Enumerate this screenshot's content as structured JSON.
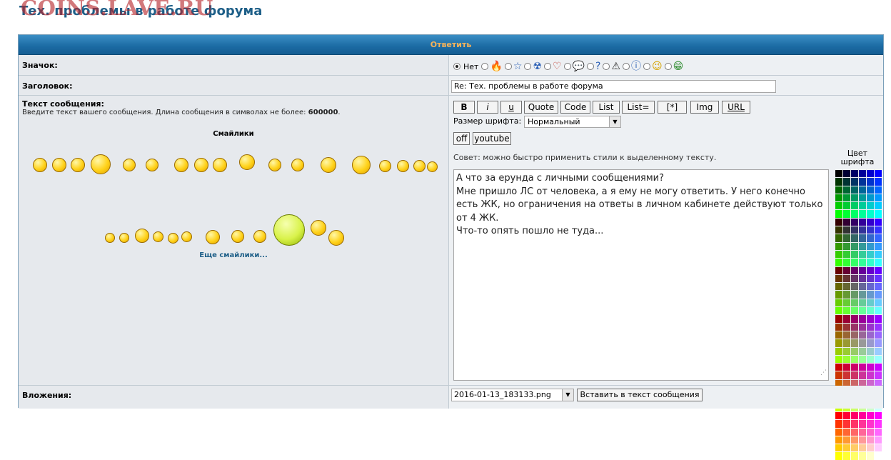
{
  "page": {
    "title": "Тех. проблемы в работе форума",
    "watermark": "COINS.LAVE.RU"
  },
  "form": {
    "header": "Ответить",
    "icon_row": {
      "label": "Значок:",
      "none_label": "Нет",
      "icons": [
        {
          "name": "fire-icon",
          "glyph": "🔥",
          "color": "#d64a1c"
        },
        {
          "name": "star-icon",
          "glyph": "☆",
          "color": "#2a5fb5"
        },
        {
          "name": "radioactive-icon",
          "glyph": "☢",
          "color": "#2a5fb5"
        },
        {
          "name": "heart-icon",
          "glyph": "♡",
          "color": "#c0392b"
        },
        {
          "name": "speech-bubble-icon",
          "glyph": "💬",
          "color": "#2a5fb5"
        },
        {
          "name": "question-icon",
          "glyph": "?",
          "color": "#2a5fb5"
        },
        {
          "name": "warning-icon",
          "glyph": "⚠",
          "color": "#333333"
        },
        {
          "name": "info-icon",
          "glyph": "ⓘ",
          "color": "#2a5fb5"
        },
        {
          "name": "wink-smiley-icon",
          "glyph": "😉",
          "color": "#d6a400"
        },
        {
          "name": "grin-smiley-icon",
          "glyph": "😁",
          "color": "#2e8b2e"
        }
      ]
    },
    "subject": {
      "label": "Заголовок:",
      "value": "Re: Тех. проблемы в работе форума"
    },
    "message": {
      "label": "Текст сообщения:",
      "hint_prefix": "Введите текст вашего сообщения. Длина сообщения в символах не более: ",
      "max_len": "600000",
      "hint_suffix": ".",
      "smilies_title": "Смайлики",
      "more_smilies": "Еще смайлики...",
      "toolbar": [
        "B",
        "i",
        "u",
        "Quote",
        "Code",
        "List",
        "List=",
        "[*]",
        "Img",
        "URL"
      ],
      "font_size_label": "Размер шрифта:",
      "font_size_value": "Нормальный",
      "extra_buttons": [
        "off",
        "youtube"
      ],
      "tip": "Совет: можно быстро применить стили к выделенному тексту.",
      "font_color_label_1": "Цвет",
      "font_color_label_2": "шрифта",
      "text": "А что за ерунда с личными сообщениями?\nМне пришло ЛС от человека, а я ему не могу ответить. У него конечно есть ЖК, но ограничения на ответы в личном кабинете действуют только от 4 ЖК.\nЧто-то опять пошло не туда..."
    },
    "attachments": {
      "label": "Вложения:",
      "file": "2016-01-13_183133.png",
      "insert_button": "Вставить в текст сообщения"
    }
  },
  "colors": {
    "header_bg": "#1b6aa3",
    "header_text": "#f7b35a",
    "title": "#1e5f88",
    "watermark": "#b8262c",
    "link": "#1e5f88"
  },
  "palette": [
    "#000000",
    "#000033",
    "#000066",
    "#000099",
    "#0000cc",
    "#0000ff",
    "#003300",
    "#003333",
    "#003366",
    "#003399",
    "#0033cc",
    "#0033ff",
    "#006600",
    "#006633",
    "#006666",
    "#006699",
    "#0066cc",
    "#0066ff",
    "#009900",
    "#009933",
    "#009966",
    "#009999",
    "#0099cc",
    "#0099ff",
    "#00cc00",
    "#00cc33",
    "#00cc66",
    "#00cc99",
    "#00cccc",
    "#00ccff",
    "#00ff00",
    "#00ff33",
    "#00ff66",
    "#00ff99",
    "#00ffcc",
    "#00ffff",
    "#330000",
    "#330033",
    "#330066",
    "#330099",
    "#3300cc",
    "#3300ff",
    "#333300",
    "#333333",
    "#333366",
    "#333399",
    "#3333cc",
    "#3333ff",
    "#336600",
    "#336633",
    "#336666",
    "#336699",
    "#3366cc",
    "#3366ff",
    "#339900",
    "#339933",
    "#339966",
    "#339999",
    "#3399cc",
    "#3399ff",
    "#33cc00",
    "#33cc33",
    "#33cc66",
    "#33cc99",
    "#33cccc",
    "#33ccff",
    "#33ff00",
    "#33ff33",
    "#33ff66",
    "#33ff99",
    "#33ffcc",
    "#33ffff",
    "#660000",
    "#660033",
    "#660066",
    "#660099",
    "#6600cc",
    "#6600ff",
    "#663300",
    "#663333",
    "#663366",
    "#663399",
    "#6633cc",
    "#6633ff",
    "#666600",
    "#666633",
    "#666666",
    "#666699",
    "#6666cc",
    "#6666ff",
    "#669900",
    "#669933",
    "#669966",
    "#669999",
    "#6699cc",
    "#6699ff",
    "#66cc00",
    "#66cc33",
    "#66cc66",
    "#66cc99",
    "#66cccc",
    "#66ccff",
    "#66ff00",
    "#66ff33",
    "#66ff66",
    "#66ff99",
    "#66ffcc",
    "#66ffff",
    "#990000",
    "#990033",
    "#990066",
    "#990099",
    "#9900cc",
    "#9900ff",
    "#993300",
    "#993333",
    "#993366",
    "#993399",
    "#9933cc",
    "#9933ff",
    "#996600",
    "#996633",
    "#996666",
    "#996699",
    "#9966cc",
    "#9966ff",
    "#999900",
    "#999933",
    "#999966",
    "#999999",
    "#9999cc",
    "#9999ff",
    "#99cc00",
    "#99cc33",
    "#99cc66",
    "#99cc99",
    "#99cccc",
    "#99ccff",
    "#99ff00",
    "#99ff33",
    "#99ff66",
    "#99ff99",
    "#99ffcc",
    "#99ffff",
    "#cc0000",
    "#cc0033",
    "#cc0066",
    "#cc0099",
    "#cc00cc",
    "#cc00ff",
    "#cc3300",
    "#cc3333",
    "#cc3366",
    "#cc3399",
    "#cc33cc",
    "#cc33ff",
    "#cc6600",
    "#cc6633",
    "#cc6666",
    "#cc6699",
    "#cc66cc",
    "#cc66ff",
    "#cc9900",
    "#cc9933",
    "#cc9966",
    "#cc9999",
    "#cc99cc",
    "#cc99ff",
    "#cccc00",
    "#cccc33",
    "#cccc66",
    "#cccc99",
    "#cccccc",
    "#ccccff",
    "#ccff00",
    "#ccff33",
    "#ccff66",
    "#ccff99",
    "#ccffcc",
    "#ccffff",
    "#ff0000",
    "#ff0033",
    "#ff0066",
    "#ff0099",
    "#ff00cc",
    "#ff00ff",
    "#ff3300",
    "#ff3333",
    "#ff3366",
    "#ff3399",
    "#ff33cc",
    "#ff33ff",
    "#ff6600",
    "#ff6633",
    "#ff6666",
    "#ff6699",
    "#ff66cc",
    "#ff66ff",
    "#ff9900",
    "#ff9933",
    "#ff9966",
    "#ff9999",
    "#ff99cc",
    "#ff99ff",
    "#ffcc00",
    "#ffcc33",
    "#ffcc66",
    "#ffcc99",
    "#ffcccc",
    "#ffccff",
    "#ffff00",
    "#ffff33",
    "#ffff66",
    "#ffff99",
    "#ffffcc",
    "#ffffff"
  ]
}
